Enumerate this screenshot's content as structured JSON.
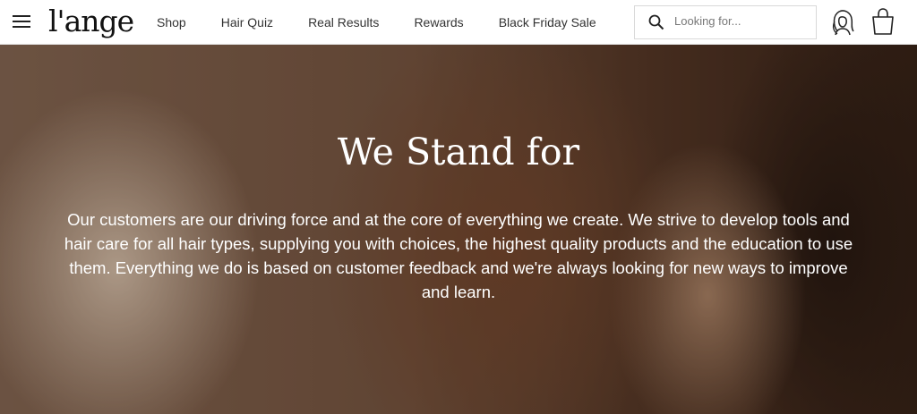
{
  "nav": {
    "logo": "l'ange",
    "links": [
      "Shop",
      "Hair Quiz",
      "Real Results",
      "Rewards",
      "Black Friday Sale"
    ]
  },
  "search": {
    "placeholder": "Looking for..."
  },
  "hero": {
    "title": "We Stand for",
    "body": "Our customers are our driving force and at the core of everything we create. We strive to develop tools and hair care for all hair types, supplying you with choices, the highest quality products and the education to use them. Everything we do is based on customer feedback and we're always looking for new ways to improve and learn."
  }
}
